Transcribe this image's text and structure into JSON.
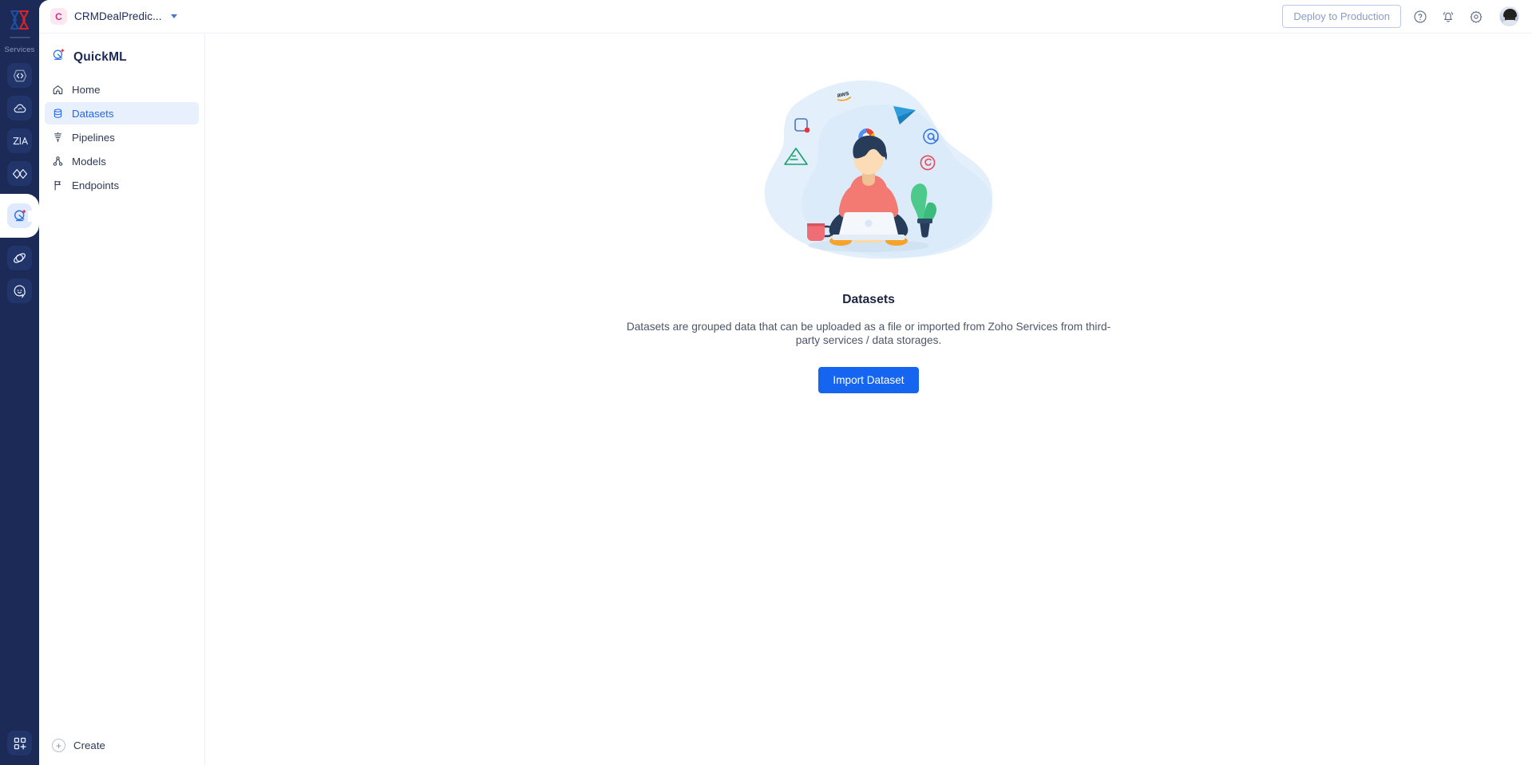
{
  "colors": {
    "rail_bg": "#1b2a57",
    "rail_tile": "#22356b",
    "accent_blue": "#1565f0",
    "nav_active_bg": "#e9f0fd",
    "nav_active_text": "#2563eb",
    "illustration_blob": "#e3effa",
    "org_avatar_bg": "#fde8f1",
    "org_avatar_text": "#c9348b"
  },
  "rail": {
    "logo_icon": "zoho-logo-icon",
    "divider": true,
    "services_label": "Services",
    "items": [
      {
        "icon": "catalyst-code-icon",
        "active": false
      },
      {
        "icon": "cloud-icon",
        "active": false
      },
      {
        "icon": "zia-icon",
        "active": false
      },
      {
        "icon": "diamonds-icon",
        "active": false
      },
      {
        "icon": "quickml-satellite-icon",
        "active": true
      },
      {
        "icon": "orbit-icon",
        "active": false
      },
      {
        "icon": "smiley-face-icon",
        "active": false
      }
    ],
    "bottom_item": {
      "icon": "apps-grid-plus-icon"
    }
  },
  "topbar": {
    "org": {
      "avatar_letter": "C",
      "name": "CRMDealPredic...",
      "caret_icon": "chevron-down-icon"
    },
    "deploy_label": "Deploy to Production",
    "icons": [
      {
        "name": "help-icon",
        "glyph": "?"
      },
      {
        "name": "notifications-bell-icon",
        "glyph": "bell"
      },
      {
        "name": "settings-gear-icon",
        "glyph": "gear"
      }
    ],
    "avatar": {
      "name": "user-avatar"
    }
  },
  "sidebar": {
    "brand": {
      "name": "QuickML",
      "icon": "quickml-satellite-icon"
    },
    "items": [
      {
        "label": "Home",
        "icon": "home-icon",
        "active": false
      },
      {
        "label": "Datasets",
        "icon": "database-icon",
        "active": true
      },
      {
        "label": "Pipelines",
        "icon": "funnel-icon",
        "active": false
      },
      {
        "label": "Models",
        "icon": "models-nodes-icon",
        "active": false
      },
      {
        "label": "Endpoints",
        "icon": "flag-icon",
        "active": false
      }
    ],
    "create": {
      "label": "Create",
      "icon": "plus-circle-icon"
    }
  },
  "main": {
    "empty_state": {
      "illustration": "person-with-laptop-and-service-icons",
      "title": "Datasets",
      "description": "Datasets are grouped data that can be uploaded as a file or imported from Zoho Services from third-party services / data storages.",
      "button_label": "Import Dataset"
    }
  }
}
